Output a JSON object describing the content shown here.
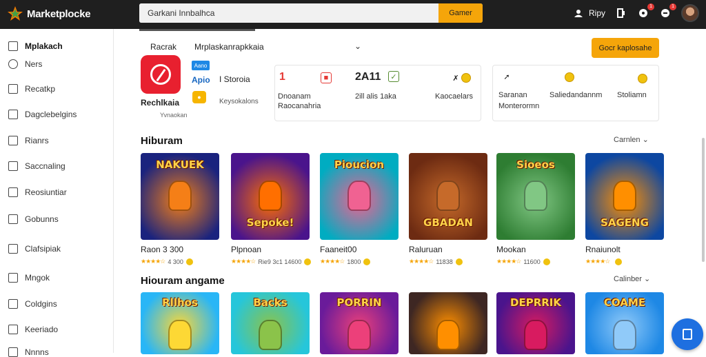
{
  "header": {
    "logo_text": "Marketplocke",
    "search_value": "Garkani Innbalhca",
    "search_button": "Gamer",
    "user_label": "Ripy",
    "notif_badge_1": "1",
    "notif_badge_2": "1"
  },
  "sidebar": {
    "items": [
      {
        "label": "Mplakach",
        "icon": "store-icon"
      },
      {
        "label": "Ners",
        "icon": "search-icon"
      },
      {
        "label": "Recatkp",
        "icon": "library-icon"
      },
      {
        "label": "Dagclebelgins",
        "icon": "category-icon"
      },
      {
        "label": "Rianrs",
        "icon": "list-icon"
      },
      {
        "label": "Saccnaling",
        "icon": "chart-icon"
      },
      {
        "label": "Reosiuntiar",
        "icon": "box-icon"
      },
      {
        "label": "Gobunns",
        "icon": "grid-icon"
      },
      {
        "label": "Clafsipiak",
        "icon": "bookmark-icon"
      },
      {
        "label": "Mngok",
        "icon": "tag-icon"
      },
      {
        "label": "Coldgins",
        "icon": "gift-icon"
      },
      {
        "label": "Keeriado",
        "icon": "settings-icon"
      },
      {
        "label": "Nnnns",
        "icon": "help-icon"
      }
    ]
  },
  "filter": {
    "label": "Racrak",
    "value": "Mrplaskanrapkkaia"
  },
  "cta_label": "Gocr kaplosahe",
  "featured": {
    "name": "Rechlkaia",
    "sub": "Yvnaokan",
    "pill": "Aano",
    "link": "Apio",
    "detail": "I Storoia",
    "meta": "Keysokalons"
  },
  "stats": {
    "card1_big": "1",
    "card1_line1": "Dnoanam",
    "card1_line2": "Raocanahria",
    "card2_big": "2A11",
    "card2_line": "2ill alis 1aka",
    "card3_line": "Kaocaelars",
    "card4_line1": "Saranan",
    "card4_line2": "Monterormn",
    "card5_line": "Saliedandannm",
    "card6_line": "Stoliamn"
  },
  "section1": {
    "title": "Hiburam",
    "more": "Carnlen",
    "games": [
      {
        "tile_text": "NAKUEK",
        "name": "Raon 3 300",
        "rating": "4 300",
        "colors": [
          "#1a237e",
          "#f57f17"
        ]
      },
      {
        "tile_text": "Sepoke!",
        "name": "Plpnoan",
        "rating": "Rie9 3c1 14600",
        "colors": [
          "#4a148c",
          "#ff6f00"
        ]
      },
      {
        "tile_text": "Pioucion",
        "name": "Faaneit00",
        "rating": "1800",
        "colors": [
          "#00acc1",
          "#f06292"
        ]
      },
      {
        "tile_text": "GBADAN",
        "name": "Raluruan",
        "rating": "11838",
        "colors": [
          "#6d2b12",
          "#c66a2a"
        ]
      },
      {
        "tile_text": "Sioeos",
        "name": "Mookan",
        "rating": "11600",
        "colors": [
          "#2e7d32",
          "#81c784"
        ]
      },
      {
        "tile_text": "SAGENG",
        "name": "Rnaiunolt",
        "rating": "",
        "colors": [
          "#0d47a1",
          "#ff8f00"
        ]
      }
    ]
  },
  "section2": {
    "title": "Hiouram angame",
    "more": "Calinber",
    "games": [
      {
        "tile_text": "Rllhos",
        "colors": [
          "#29b6f6",
          "#fdd835"
        ]
      },
      {
        "tile_text": "Backs",
        "colors": [
          "#26c6da",
          "#8bc34a"
        ]
      },
      {
        "tile_text": "PORRIN",
        "colors": [
          "#6a1b9a",
          "#ec407a"
        ]
      },
      {
        "tile_text": "",
        "colors": [
          "#3e2723",
          "#ff8f00"
        ]
      },
      {
        "tile_text": "DEPRRIK",
        "colors": [
          "#4a148c",
          "#d81b60"
        ]
      },
      {
        "tile_text": "COAME",
        "colors": [
          "#1e88e5",
          "#90caf9"
        ]
      }
    ]
  },
  "colors": {
    "accent": "#f5a50a",
    "topbar": "#1f1f1f",
    "fab": "#1e6fe0"
  }
}
